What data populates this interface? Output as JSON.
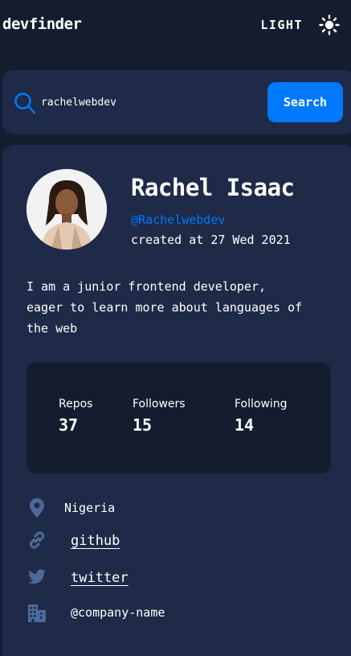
{
  "header": {
    "logo": "devfinder",
    "theme_label": "LIGHT",
    "theme_icon": "sun-icon"
  },
  "search": {
    "value": "rachelwebdev",
    "button_label": "Search",
    "icon": "search-icon"
  },
  "profile": {
    "name": "Rachel Isaac",
    "handle": "@Rachelwebdev",
    "joined": "created at 27 Wed 2021",
    "bio": "I am a junior frontend developer, eager to learn more about languages of the web",
    "avatar": "avatar-photo"
  },
  "stats": {
    "repos_label": "Repos",
    "repos_value": "37",
    "followers_label": "Followers",
    "followers_value": "15",
    "following_label": "Following",
    "following_value": "14"
  },
  "links": {
    "location": "Nigeria",
    "github": "github",
    "twitter": "twitter",
    "company": "@company-name"
  },
  "colors": {
    "background": "#141d2f",
    "card": "#1e2a47",
    "accent": "#0079ff",
    "icon": "#4b6a9b",
    "text": "#ffffff"
  }
}
